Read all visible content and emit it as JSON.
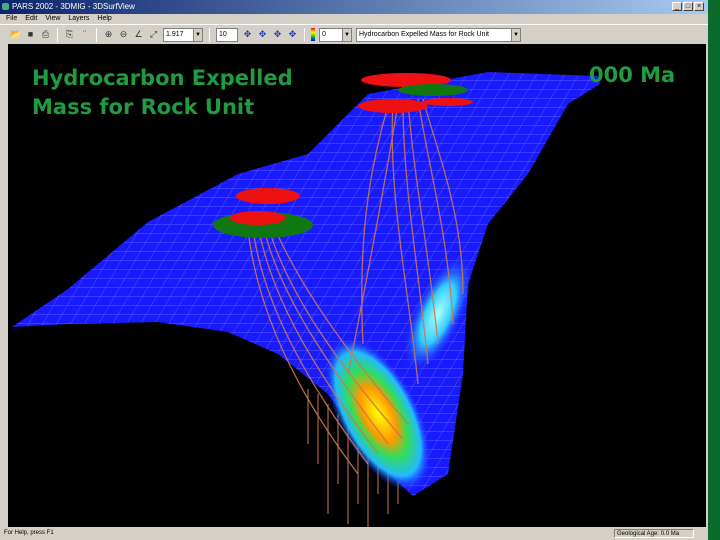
{
  "window": {
    "title": "PARS 2002 - 3DMIG - 3DSurfView"
  },
  "menu": [
    "File",
    "Edit",
    "View",
    "Layers",
    "Help"
  ],
  "toolbar": {
    "zoom_value": "1.917",
    "step_value": "10",
    "age_value": "0",
    "property_value": "Hydrocarbon Expelled Mass for Rock Unit"
  },
  "overlay": {
    "title_line1": "Hydrocarbon Expelled",
    "title_line2": "Mass for Rock Unit",
    "age_text": "000 Ma"
  },
  "status": {
    "help": "For Help, press F1",
    "age": "Geological Age: 0.0 Ma"
  },
  "colors": {
    "surface": "#1a1aff",
    "accent_green": "#1f9c3f",
    "migration": "#c87850"
  }
}
